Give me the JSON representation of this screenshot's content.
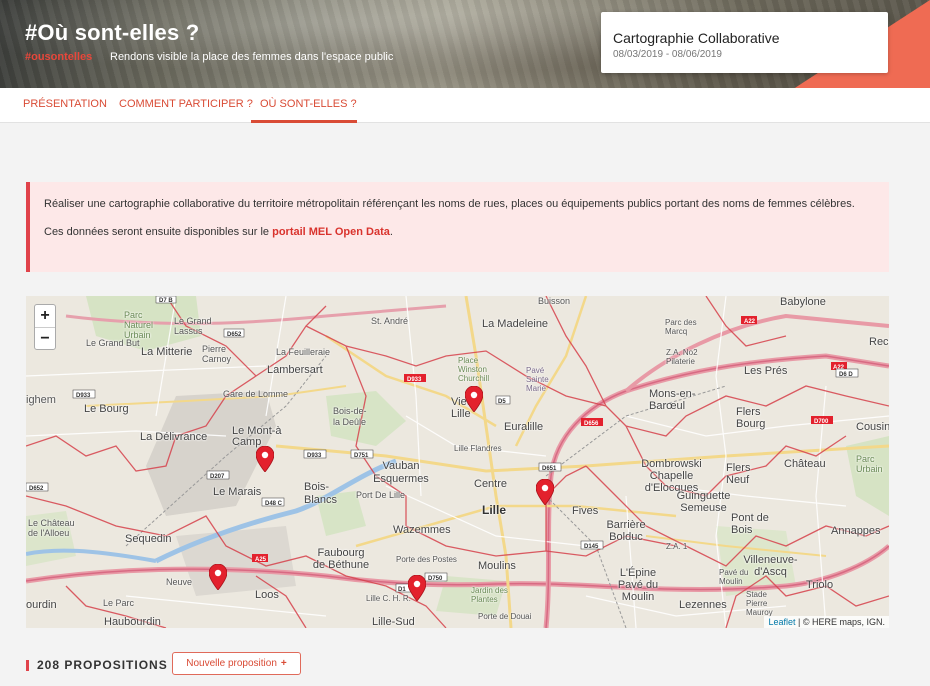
{
  "header": {
    "title": "#Où sont-elles ?",
    "hashtag": "#ousontelles",
    "tagline": "Rendons visible la place des femmes dans l'espace public"
  },
  "event_card": {
    "title": "Cartographie Collaborative",
    "dates": "08/03/2019 - 08/06/2019"
  },
  "nav": {
    "tabs": [
      {
        "label": "PRÉSENTATION",
        "active": false
      },
      {
        "label": "COMMENT PARTICIPER ?",
        "active": false
      },
      {
        "label": "OÙ SONT-ELLES ?",
        "active": true
      }
    ]
  },
  "notice": {
    "line1": "Réaliser une cartographie collaborative du territoire métropolitain référençant les noms de rues, places ou équipements publics portant des noms de femmes célèbres.",
    "line2_prefix": "Ces données seront ensuite disponibles sur le ",
    "line2_link": "portail MEL Open Data",
    "line2_suffix": "."
  },
  "map": {
    "zoom_in": "+",
    "zoom_out": "−",
    "marker_icon": "map-pin-icon",
    "marker_count": 5,
    "marker_color": "#e3212d",
    "labels": {
      "babylone": "Babylone",
      "la_madeleine": "La Madeleine",
      "buisson": "Buisson",
      "st_andre": "St. André",
      "le_grand_lassus": "Le Grand Lassus",
      "parc_naturel_urbain": "Parc Naturel Urbain",
      "la_mitterie": "La Mitterie",
      "la_feuilleraie": "La Feuilleraie",
      "lambersart": "Lambersart",
      "le_grand_but": "Le Grand But",
      "pierre_carnoy": "Pierre Carnoy",
      "gare_de_lomme": "Gare de Lomme",
      "le_bourg": "Le Bourg",
      "bois_de_la_deule": "Bois-de-la Deûle",
      "la_delivrance": "La Délivrance",
      "le_mont_a_camp": "Le Mont-à Camp",
      "le_marais": "Le Marais",
      "bois_blancs": "Bois-Blancs",
      "vauban_esquermes": "Vauban Esquermes",
      "port_de_lille": "Port De Lille",
      "sequedin": "Sequedin",
      "wazemmes": "Wazemmes",
      "lille": "Lille",
      "centre": "Centre",
      "fives": "Fives",
      "vieux_lille": "Vieux Lille",
      "euralille": "Euralille",
      "lille_flandres": "Lille Flandres",
      "place_winston_churchill": "Place Winston Churchill",
      "pave_sainte_marie": "Pavé Sainte Marie",
      "parc_des_marcq": "Parc des Marcq",
      "za_no2_pilaterie": "Z.A. No2 Pilaterie",
      "mons_en_baroeul": "Mons-en-Barœul",
      "flers_bourg": "Flers Bourg",
      "les_pres": "Les Prés",
      "recu": "Recu",
      "cousinerie": "Cousine",
      "chateau": "Château",
      "parc_urbain": "Parc Urbain",
      "flers_neuf": "Flers Neuf",
      "dombrowski": "Dombrowski Chapelle d'Elocques",
      "guinguette_semeuse": "Guinguette Semeuse",
      "barriere_bolduc": "Barrière Bolduc",
      "pont_de_bois": "Pont de Bois",
      "annappes": "Annappes",
      "villeneuve_dascq": "Villeneuve-d'Ascq",
      "triolo": "Triolo",
      "lepine_pave_du_moulin": "L'Épine Pavé du Moulin",
      "lezennes": "Lezennes",
      "moulins": "Moulins",
      "faubourg_de_bethune": "Faubourg de Béthune",
      "loos": "Loos",
      "lille_sud": "Lille-Sud",
      "haubourdin": "Haubourdin",
      "le_parc": "Le Parc",
      "ourdin": "ourdin",
      "le_chateau_de_lalloeu": "Le Château de l'Alloeu",
      "neuve": "Neuve",
      "ighem": "ighem",
      "porte_des_postes": "Porte des Postes",
      "lille_chr": "Lille C. H. R.",
      "jardin_des_plantes": "Jardin des Plantes",
      "porte_de_douai": "Porte de Douai",
      "za1": "Z.A. 1",
      "pave_du_moulin": "Pavé du Moulin",
      "stade_pierre_mauroy": "Stade Pierre Mauroy"
    },
    "attribution": {
      "leaflet": "Leaflet",
      "rest": " | © HERE maps, IGN."
    }
  },
  "footer": {
    "proposals_count": "208 PROPOSITIONS",
    "new_button": "Nouvelle proposition",
    "new_button_icon": "+"
  }
}
